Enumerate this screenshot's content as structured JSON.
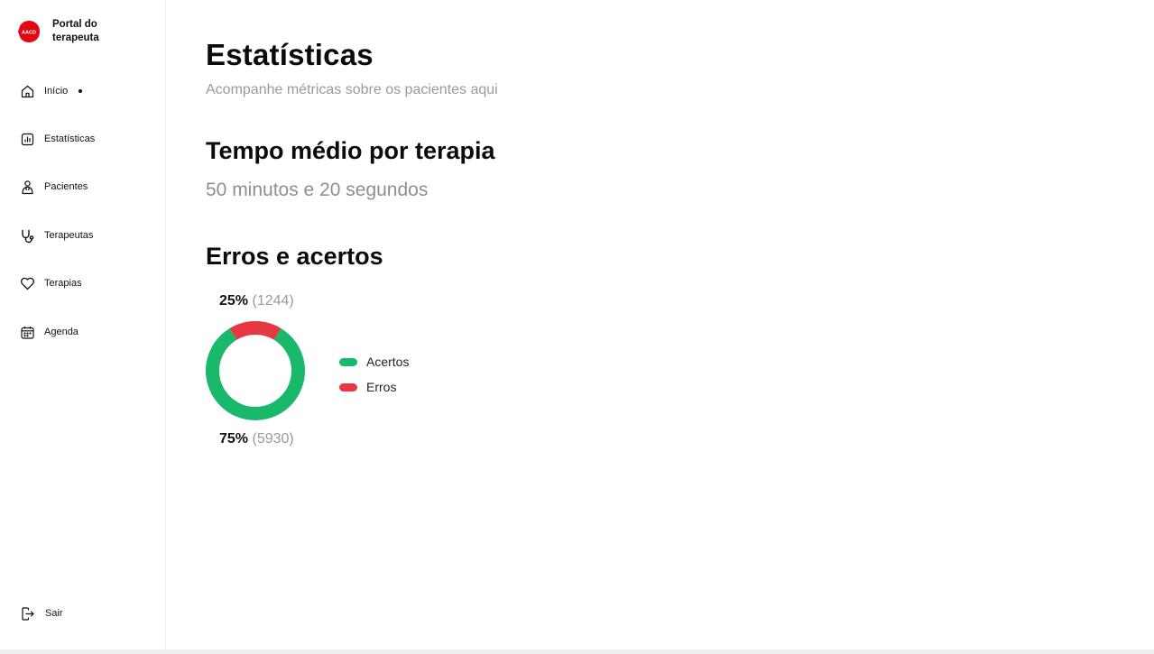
{
  "brand": {
    "logo_text": "AACD",
    "title": "Portal do terapeuta"
  },
  "nav": {
    "items": [
      {
        "label": "Início",
        "icon": "home-icon",
        "active": true
      },
      {
        "label": "Estatísticas",
        "icon": "bar-chart-icon"
      },
      {
        "label": "Pacientes",
        "icon": "patient-icon"
      },
      {
        "label": "Terapeutas",
        "icon": "stethoscope-icon"
      },
      {
        "label": "Terapias",
        "icon": "heart-icon"
      },
      {
        "label": "Agenda",
        "icon": "calendar-icon"
      }
    ],
    "logout": {
      "label": "Sair",
      "icon": "logout-icon"
    }
  },
  "page": {
    "title": "Estatísticas",
    "subtitle": "Acompanhe métricas sobre os pacientes aqui"
  },
  "avg_time": {
    "heading": "Tempo médio por terapia",
    "value": "50 minutos e 20 segundos"
  },
  "errors_hits": {
    "heading": "Erros e acertos",
    "top": {
      "percent": "25%",
      "count": "(1244)"
    },
    "bottom": {
      "percent": "75%",
      "count": "(5930)"
    },
    "legend": [
      {
        "label": "Acertos",
        "color": "#19b86b"
      },
      {
        "label": "Erros",
        "color": "#e63843"
      }
    ]
  },
  "chart_data": {
    "type": "pie",
    "categories": [
      "Acertos",
      "Erros"
    ],
    "values": [
      5930,
      1244
    ],
    "percents": [
      75,
      25
    ],
    "colors": [
      "#19b86b",
      "#e63843"
    ],
    "title": "Erros e acertos"
  },
  "colors": {
    "brand_red": "#e30613",
    "success": "#19b86b",
    "danger": "#e63843"
  }
}
